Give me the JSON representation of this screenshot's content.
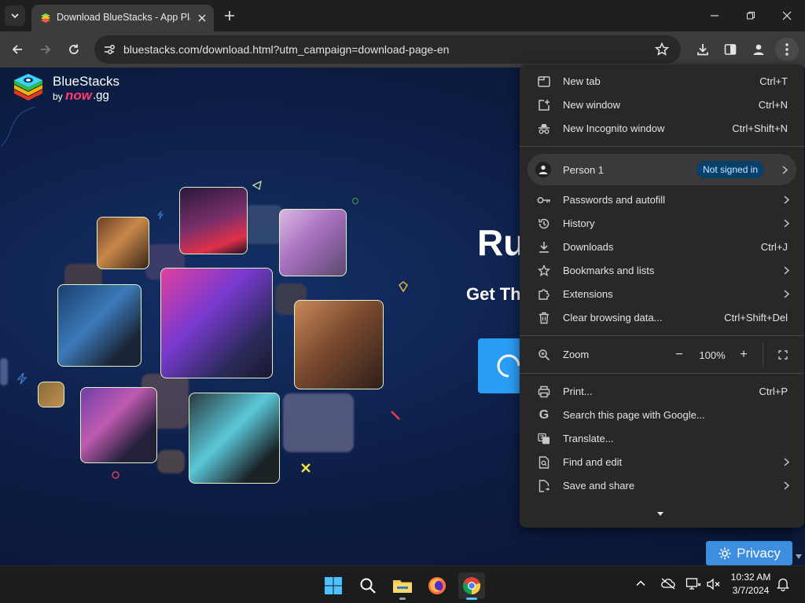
{
  "browser": {
    "tab_title": "Download BlueStacks - App Pla",
    "url": "bluestacks.com/download.html?utm_campaign=download-page-en"
  },
  "page": {
    "brand_name": "BlueStacks",
    "brand_by": "by",
    "brand_sub": "now",
    "brand_sub2": ".gg",
    "headline": "Ru",
    "subheadline": "Get Th",
    "privacy_label": "Privacy"
  },
  "menu": {
    "new_tab": {
      "label": "New tab",
      "shortcut": "Ctrl+T"
    },
    "new_window": {
      "label": "New window",
      "shortcut": "Ctrl+N"
    },
    "new_incognito": {
      "label": "New Incognito window",
      "shortcut": "Ctrl+Shift+N"
    },
    "person": {
      "label": "Person 1",
      "badge": "Not signed in"
    },
    "passwords": {
      "label": "Passwords and autofill"
    },
    "history": {
      "label": "History"
    },
    "downloads": {
      "label": "Downloads",
      "shortcut": "Ctrl+J"
    },
    "bookmarks": {
      "label": "Bookmarks and lists"
    },
    "extensions": {
      "label": "Extensions"
    },
    "clear": {
      "label": "Clear browsing data...",
      "shortcut": "Ctrl+Shift+Del"
    },
    "zoom": {
      "label": "Zoom",
      "value": "100%",
      "minus": "−",
      "plus": "+"
    },
    "print": {
      "label": "Print...",
      "shortcut": "Ctrl+P"
    },
    "search_google": {
      "label": "Search this page with Google..."
    },
    "translate": {
      "label": "Translate..."
    },
    "find_edit": {
      "label": "Find and edit"
    },
    "save_share": {
      "label": "Save and share"
    }
  },
  "taskbar": {
    "time": "10:32 AM",
    "date": "3/7/2024"
  },
  "colors": {
    "menu_bg": "#282828",
    "badge_bg": "#07406b",
    "privacy_bg": "#3d8ee0",
    "download_bg": "#2a9df4"
  }
}
